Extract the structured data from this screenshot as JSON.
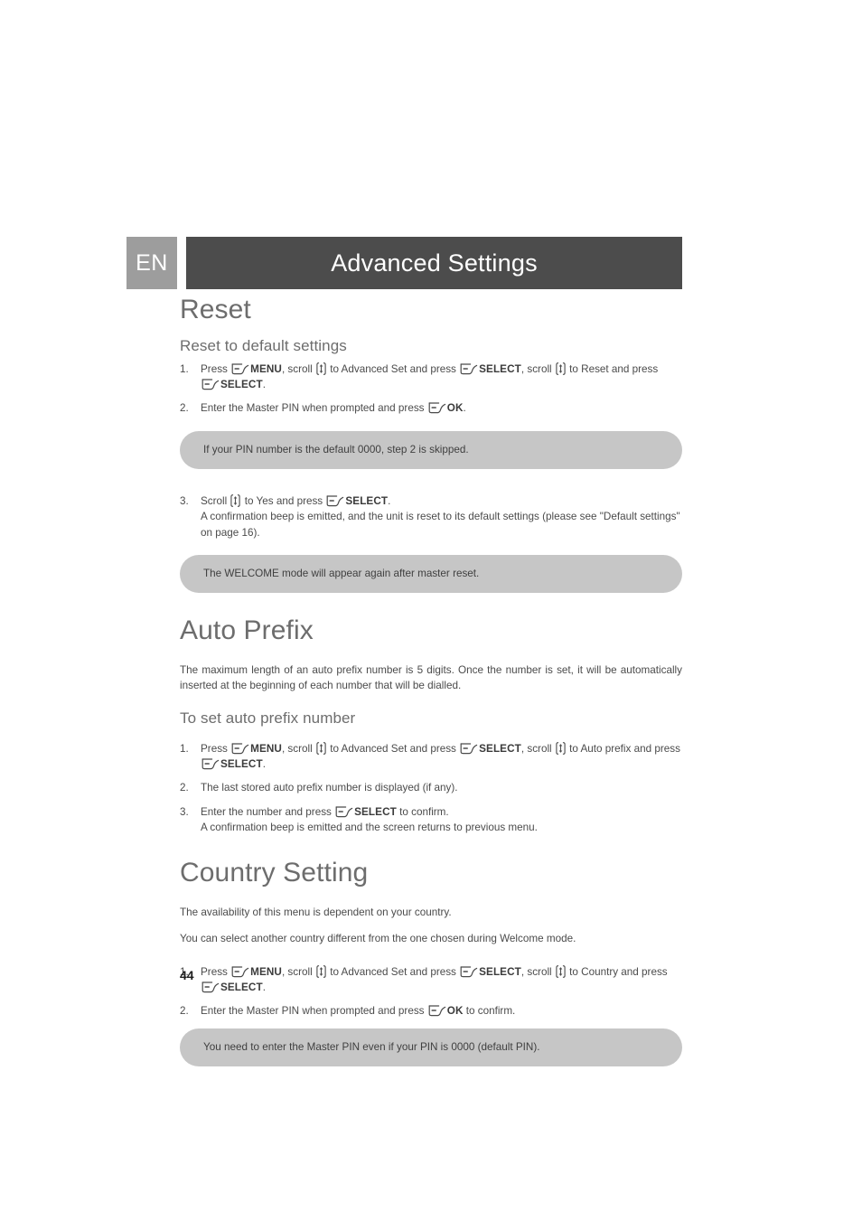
{
  "header": {
    "language_tab": "EN",
    "title": "Advanced Settings",
    "tab_bg": "#9d9d9d",
    "bar_bg": "#4c4c4c"
  },
  "icons": {
    "softkey": "softkey-button-icon",
    "scroll": "scroll-up-down-icon"
  },
  "sections": {
    "reset": {
      "title": "Reset",
      "sub_title": "Reset to default settings",
      "steps": [
        {
          "num": "1.",
          "parts": [
            {
              "t": "text",
              "v": "Press "
            },
            {
              "t": "icon",
              "v": "softkey"
            },
            {
              "t": "bold",
              "v": "MENU"
            },
            {
              "t": "text",
              "v": ", scroll "
            },
            {
              "t": "icon",
              "v": "scroll"
            },
            {
              "t": "text",
              "v": " to Advanced Set and press "
            },
            {
              "t": "icon",
              "v": "softkey"
            },
            {
              "t": "bold",
              "v": "SELECT"
            },
            {
              "t": "text",
              "v": ", scroll "
            },
            {
              "t": "icon",
              "v": "scroll"
            },
            {
              "t": "text",
              "v": " to Reset and press "
            },
            {
              "t": "break"
            },
            {
              "t": "icon",
              "v": "softkey"
            },
            {
              "t": "bold",
              "v": "SELECT"
            },
            {
              "t": "text",
              "v": "."
            }
          ]
        },
        {
          "num": "2.",
          "parts": [
            {
              "t": "text",
              "v": "Enter the Master PIN when prompted and press "
            },
            {
              "t": "icon",
              "v": "softkey"
            },
            {
              "t": "bold",
              "v": "OK"
            },
            {
              "t": "text",
              "v": "."
            }
          ]
        }
      ],
      "callout_1": "If your PIN number is the default 0000, step 2 is skipped.",
      "step_3": {
        "num": "3.",
        "parts": [
          {
            "t": "text",
            "v": "Scroll "
          },
          {
            "t": "icon",
            "v": "scroll"
          },
          {
            "t": "text",
            "v": " to Yes and press "
          },
          {
            "t": "icon",
            "v": "softkey"
          },
          {
            "t": "bold",
            "v": "SELECT"
          },
          {
            "t": "text",
            "v": "."
          }
        ],
        "detail": "A confirmation beep is emitted, and the unit is reset to its default settings (please see \"Default settings\" on page 16)."
      },
      "callout_2": "The WELCOME mode will appear again after master reset."
    },
    "auto_prefix": {
      "title": "Auto Prefix",
      "intro": "The maximum length of an auto prefix number is 5 digits. Once the number is set, it will be automatically inserted at the beginning of each number that will be dialled.",
      "sub_title": "To set auto prefix number",
      "steps": [
        {
          "num": "1.",
          "parts": [
            {
              "t": "text",
              "v": "Press "
            },
            {
              "t": "icon",
              "v": "softkey"
            },
            {
              "t": "bold",
              "v": "MENU"
            },
            {
              "t": "text",
              "v": ", scroll "
            },
            {
              "t": "icon",
              "v": "scroll"
            },
            {
              "t": "text",
              "v": " to Advanced Set and press "
            },
            {
              "t": "icon",
              "v": "softkey"
            },
            {
              "t": "bold",
              "v": "SELECT"
            },
            {
              "t": "text",
              "v": ", scroll "
            },
            {
              "t": "icon",
              "v": "scroll"
            },
            {
              "t": "text",
              "v": " to Auto prefix and press "
            },
            {
              "t": "break"
            },
            {
              "t": "icon",
              "v": "softkey"
            },
            {
              "t": "bold",
              "v": "SELECT"
            },
            {
              "t": "text",
              "v": "."
            }
          ]
        },
        {
          "num": "2.",
          "parts": [
            {
              "t": "text",
              "v": "The last stored auto prefix number is displayed (if any)."
            }
          ]
        },
        {
          "num": "3.",
          "parts": [
            {
              "t": "text",
              "v": "Enter the number and press "
            },
            {
              "t": "icon",
              "v": "softkey"
            },
            {
              "t": "bold",
              "v": "SELECT"
            },
            {
              "t": "text",
              "v": " to confirm."
            },
            {
              "t": "detail",
              "v": "A confirmation beep is emitted and the screen returns to previous menu."
            }
          ]
        }
      ]
    },
    "country_setting": {
      "title": "Country Setting",
      "intro_1": "The availability of this menu is dependent on your country.",
      "intro_2": "You can select another country different from the one chosen during Welcome mode.",
      "steps": [
        {
          "num": "1.",
          "parts": [
            {
              "t": "text",
              "v": "Press "
            },
            {
              "t": "icon",
              "v": "softkey"
            },
            {
              "t": "bold",
              "v": "MENU"
            },
            {
              "t": "text",
              "v": ", scroll "
            },
            {
              "t": "icon",
              "v": "scroll"
            },
            {
              "t": "text",
              "v": " to Advanced Set and press "
            },
            {
              "t": "icon",
              "v": "softkey"
            },
            {
              "t": "bold",
              "v": "SELECT"
            },
            {
              "t": "text",
              "v": ", scroll "
            },
            {
              "t": "icon",
              "v": "scroll"
            },
            {
              "t": "text",
              "v": " to Country and press "
            },
            {
              "t": "break"
            },
            {
              "t": "icon",
              "v": "softkey"
            },
            {
              "t": "bold",
              "v": "SELECT"
            },
            {
              "t": "text",
              "v": "."
            }
          ]
        },
        {
          "num": "2.",
          "parts": [
            {
              "t": "text",
              "v": "Enter the Master PIN when prompted and press "
            },
            {
              "t": "icon",
              "v": "softkey"
            },
            {
              "t": "bold",
              "v": "OK"
            },
            {
              "t": "text",
              "v": " to confirm."
            }
          ]
        }
      ],
      "callout": "You need to enter the Master PIN even if your PIN is 0000 (default PIN)."
    }
  },
  "footer": {
    "page_number": "44"
  }
}
